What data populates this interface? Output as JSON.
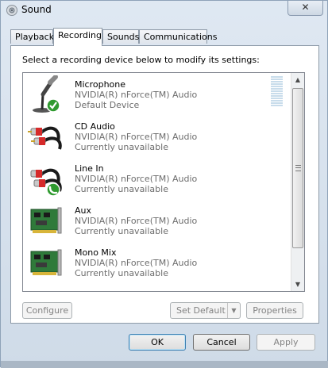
{
  "window": {
    "title": "Sound",
    "close_glyph": "✕",
    "title_icon": "speaker-icon"
  },
  "tabs": [
    {
      "label": "Playback",
      "active": false
    },
    {
      "label": "Recording",
      "active": true
    },
    {
      "label": "Sounds",
      "active": false
    },
    {
      "label": "Communications",
      "active": false
    }
  ],
  "instruction": "Select a recording device below to modify its settings:",
  "devices": [
    {
      "name": "Microphone",
      "driver": "NVIDIA(R) nForce(TM) Audio",
      "status": "Default Device",
      "icon": "microphone-icon",
      "badge": "default-check"
    },
    {
      "name": "CD Audio",
      "driver": "NVIDIA(R) nForce(TM) Audio",
      "status": "Currently unavailable",
      "icon": "rca-cable-icon",
      "badge": "none"
    },
    {
      "name": "Line In",
      "driver": "NVIDIA(R) nForce(TM) Audio",
      "status": "Currently unavailable",
      "icon": "rca-cable-icon",
      "badge": "communications-phone"
    },
    {
      "name": "Aux",
      "driver": "NVIDIA(R) nForce(TM) Audio",
      "status": "Currently unavailable",
      "icon": "sound-card-icon",
      "badge": "none"
    },
    {
      "name": "Mono Mix",
      "driver": "NVIDIA(R) nForce(TM) Audio",
      "status": "Currently unavailable",
      "icon": "sound-card-icon",
      "badge": "none"
    }
  ],
  "buttons": {
    "configure": "Configure",
    "set_default": "Set Default",
    "properties": "Properties",
    "ok": "OK",
    "cancel": "Cancel",
    "apply": "Apply"
  },
  "colors": {
    "accent": "#3c7fb1",
    "check_green": "#2f9a2f",
    "disabled_text": "#838383"
  }
}
